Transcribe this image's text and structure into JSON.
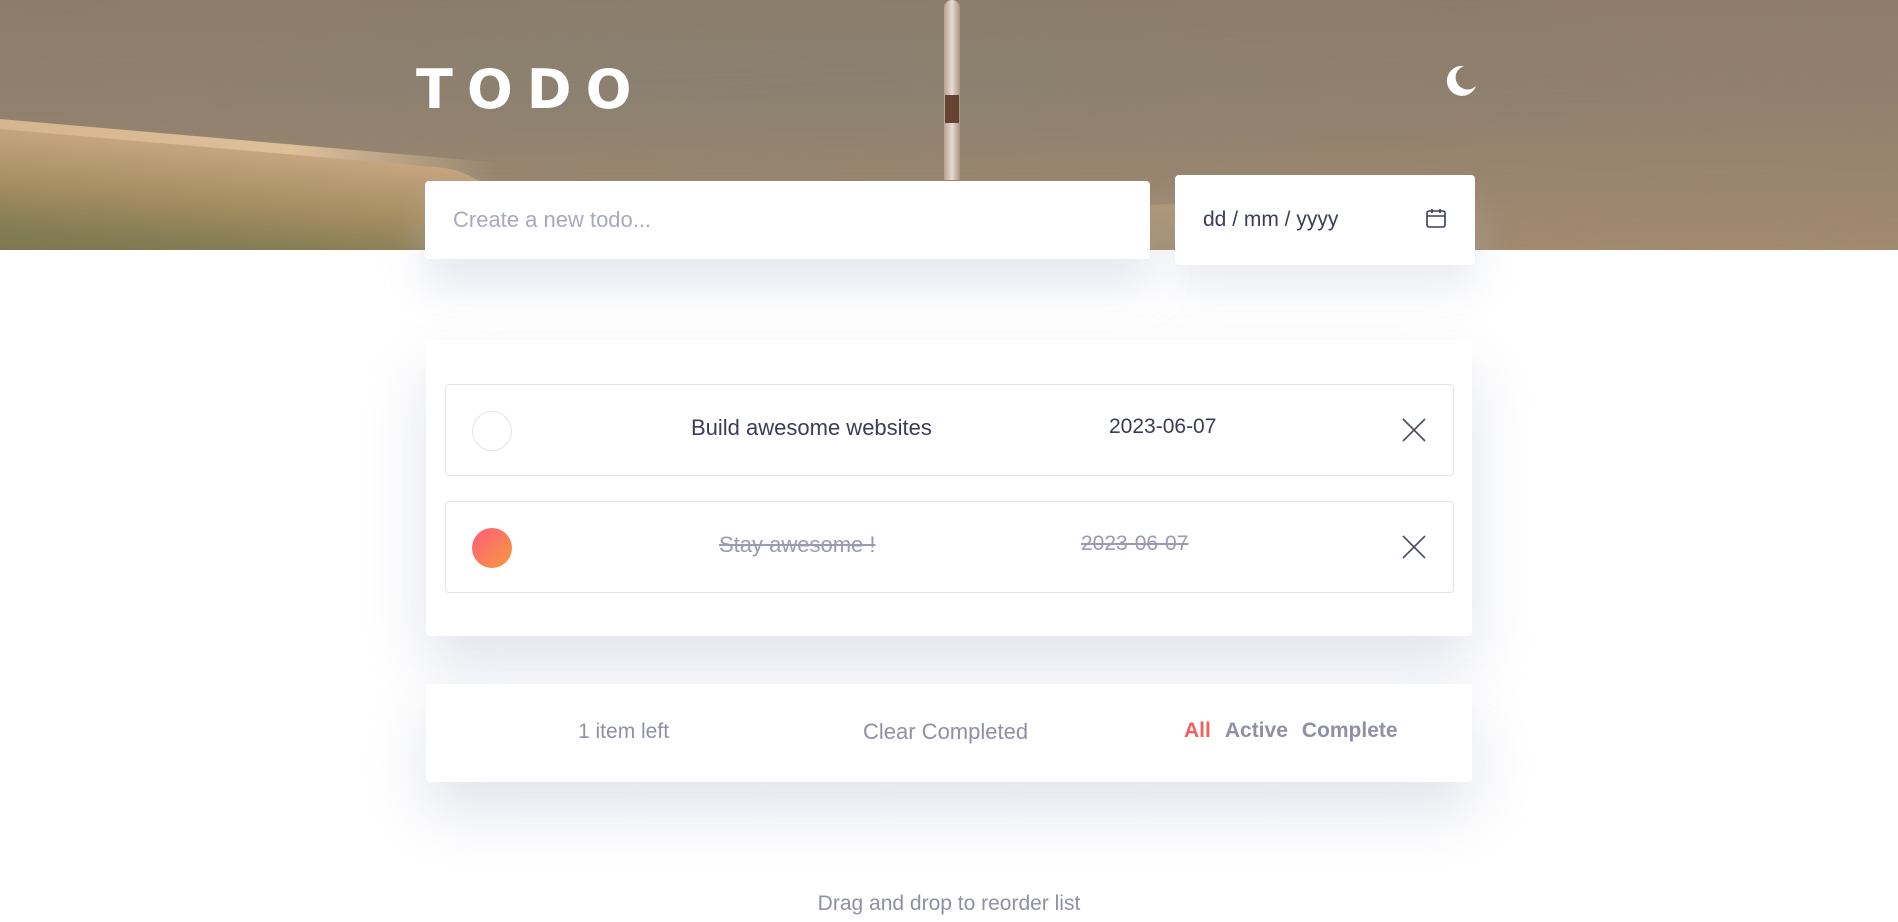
{
  "header": {
    "title": "TODO",
    "theme_icon": "moon-icon"
  },
  "form": {
    "new_todo_placeholder": "Create a new todo...",
    "new_todo_value": "",
    "date_value": "dd / mm / yyyy",
    "date_icon": "calendar-icon"
  },
  "todos": [
    {
      "text": "Build awesome websites",
      "date": "2023-06-07",
      "completed": false
    },
    {
      "text": "Stay awesome !",
      "date": "2023-06-07",
      "completed": true
    }
  ],
  "footer": {
    "items_left": "1 item left",
    "clear_completed": "Clear Completed",
    "filters": [
      "All",
      "Active",
      "Complete"
    ],
    "active_filter": "All"
  },
  "hint": "Drag and drop to reorder list",
  "colors": {
    "accent": "#f25f62",
    "text": "#3a3d58",
    "muted": "#8f90a6",
    "check_gradient_start": "#ff5c7c",
    "check_gradient_end": "#f59b3c"
  }
}
